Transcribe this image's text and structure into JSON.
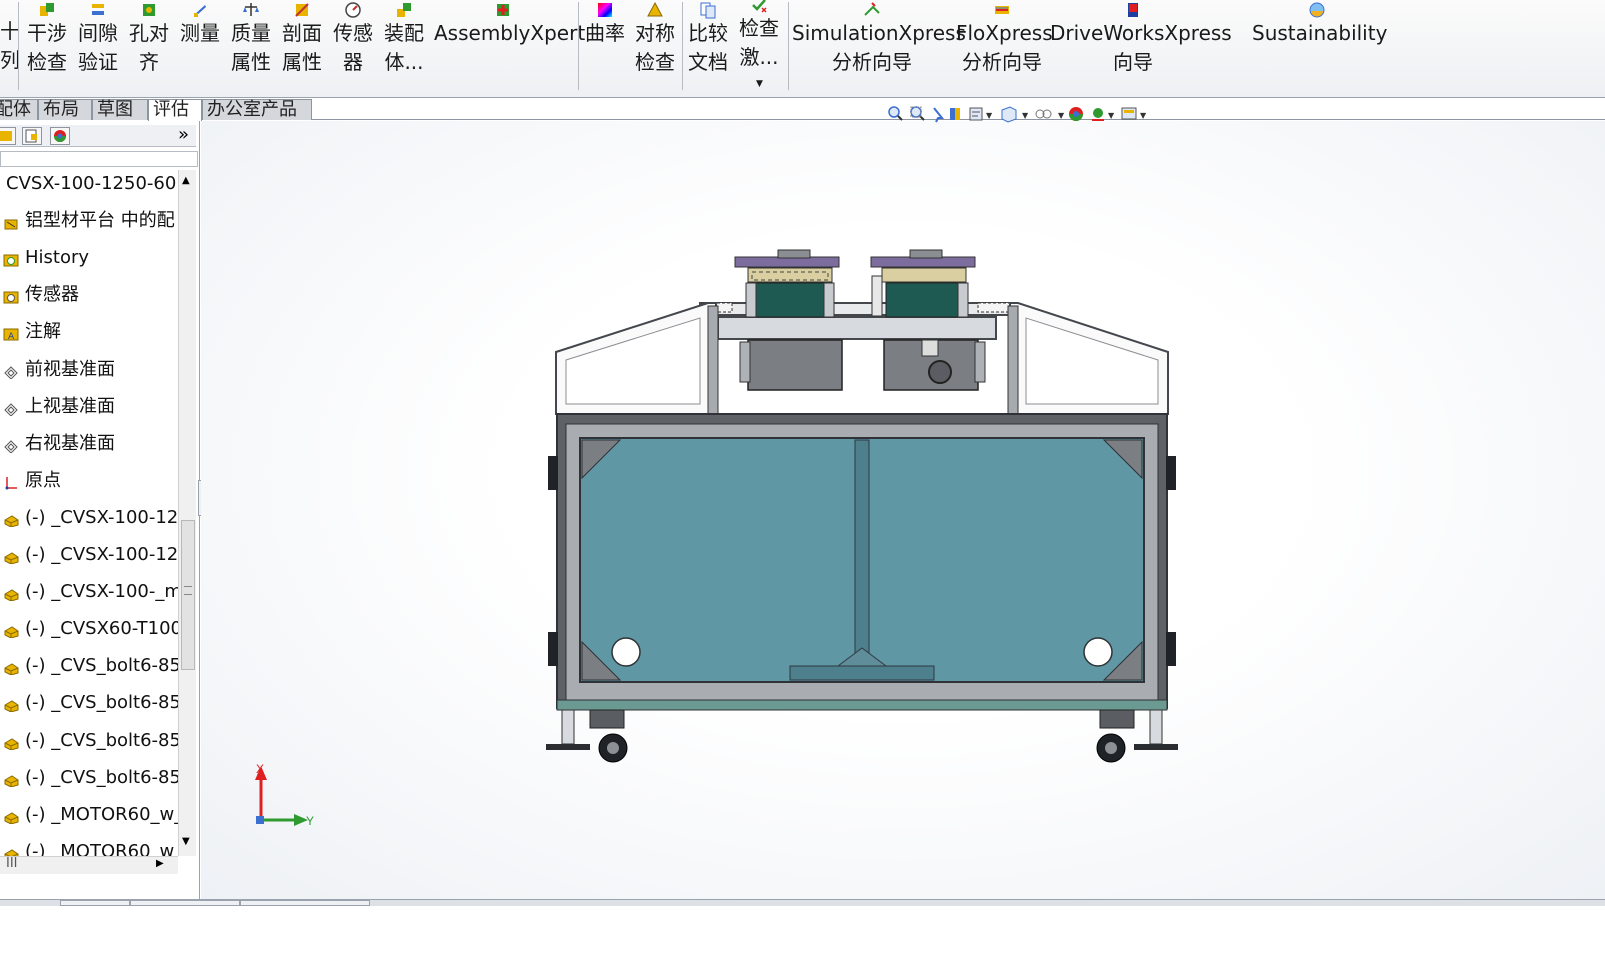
{
  "ribbon": {
    "edge_left": {
      "line1": "十",
      "line2": "列"
    },
    "buttons": [
      {
        "id": "interference",
        "line1": "干涉",
        "line2": "检查",
        "icon": "interference-icon"
      },
      {
        "id": "clearance",
        "line1": "间隙",
        "line2": "验证",
        "icon": "clearance-icon"
      },
      {
        "id": "hole-align",
        "line1": "孔对",
        "line2": "齐",
        "icon": "hole-align-icon"
      },
      {
        "id": "measure",
        "line1": "测量",
        "line2": "",
        "icon": "measure-icon"
      },
      {
        "id": "mass-props",
        "line1": "质量",
        "line2": "属性",
        "icon": "mass-icon"
      },
      {
        "id": "section-props",
        "line1": "剖面",
        "line2": "属性",
        "icon": "section-icon"
      },
      {
        "id": "sensor",
        "line1": "传感",
        "line2": "器",
        "icon": "sensor-icon"
      },
      {
        "id": "assembly-viz",
        "line1": "装配",
        "line2": "体...",
        "icon": "assembly-icon"
      },
      {
        "id": "assemblyxpert",
        "line1": "AssemblyXpert",
        "line2": "",
        "icon": "assemblyxpert-icon"
      },
      {
        "id": "curvature",
        "line1": "曲率",
        "line2": "",
        "icon": "curvature-icon"
      },
      {
        "id": "symmetry",
        "line1": "对称",
        "line2": "检查",
        "icon": "symmetry-icon"
      },
      {
        "id": "compare",
        "line1": "比较",
        "line2": "文档",
        "icon": "compare-icon"
      },
      {
        "id": "check-active",
        "line1": "检查",
        "line2": "激...",
        "icon": "check-icon"
      },
      {
        "id": "simulationxpress",
        "line1": "SimulationXpress",
        "line2": "分析向导",
        "icon": "simulation-icon"
      },
      {
        "id": "floxpress",
        "line1": "FloXpress",
        "line2": "分析向导",
        "icon": "flow-icon"
      },
      {
        "id": "driveworksxpress",
        "line1": "DriveWorksXpress",
        "line2": "向导",
        "icon": "driveworks-icon"
      },
      {
        "id": "sustainability",
        "line1": "Sustainability",
        "line2": "",
        "icon": "sustainability-icon"
      }
    ]
  },
  "tabs": [
    {
      "label": "配体",
      "active": false
    },
    {
      "label": "布局",
      "active": false
    },
    {
      "label": "草图",
      "active": false
    },
    {
      "label": "评估",
      "active": true
    },
    {
      "label": "办公室产品",
      "active": false
    }
  ],
  "panel": {
    "expand_label": "»",
    "tree": [
      {
        "label": "CVSX-100-1250-60",
        "icon": "assembly-root-icon",
        "root": true
      },
      {
        "label": "铝型材平台 中的配",
        "icon": "mates-icon"
      },
      {
        "label": "History",
        "icon": "history-icon"
      },
      {
        "label": "传感器",
        "icon": "sensor-folder-icon"
      },
      {
        "label": "注解",
        "icon": "annotation-icon"
      },
      {
        "label": "前视基准面",
        "icon": "plane-icon"
      },
      {
        "label": "上视基准面",
        "icon": "plane-icon"
      },
      {
        "label": "右视基准面",
        "icon": "plane-icon"
      },
      {
        "label": "原点",
        "icon": "origin-icon"
      },
      {
        "label": "(-) _CVSX-100-12",
        "icon": "part-icon"
      },
      {
        "label": "(-) _CVSX-100-12",
        "icon": "part-icon"
      },
      {
        "label": "(-) _CVSX-100-_m",
        "icon": "part-icon"
      },
      {
        "label": "(-) _CVSX60-T100",
        "icon": "part-icon"
      },
      {
        "label": "(-) _CVS_bolt6-85",
        "icon": "part-icon"
      },
      {
        "label": "(-) _CVS_bolt6-85",
        "icon": "part-icon"
      },
      {
        "label": "(-) _CVS_bolt6-85",
        "icon": "part-icon"
      },
      {
        "label": "(-) _CVS_bolt6-85",
        "icon": "part-icon"
      },
      {
        "label": "(-) _MOTOR60_w_",
        "icon": "part-icon"
      },
      {
        "label": "(-) _MOTOR60_w_",
        "icon": "part-icon"
      }
    ],
    "scroll_handle": "III"
  },
  "triad": {
    "x_label": "X",
    "y_label": "Y"
  },
  "colors": {
    "glass": "#5f97a4",
    "frame": "#5e6267",
    "ribbon": "#eef0f3",
    "accent": "#ff0000"
  }
}
